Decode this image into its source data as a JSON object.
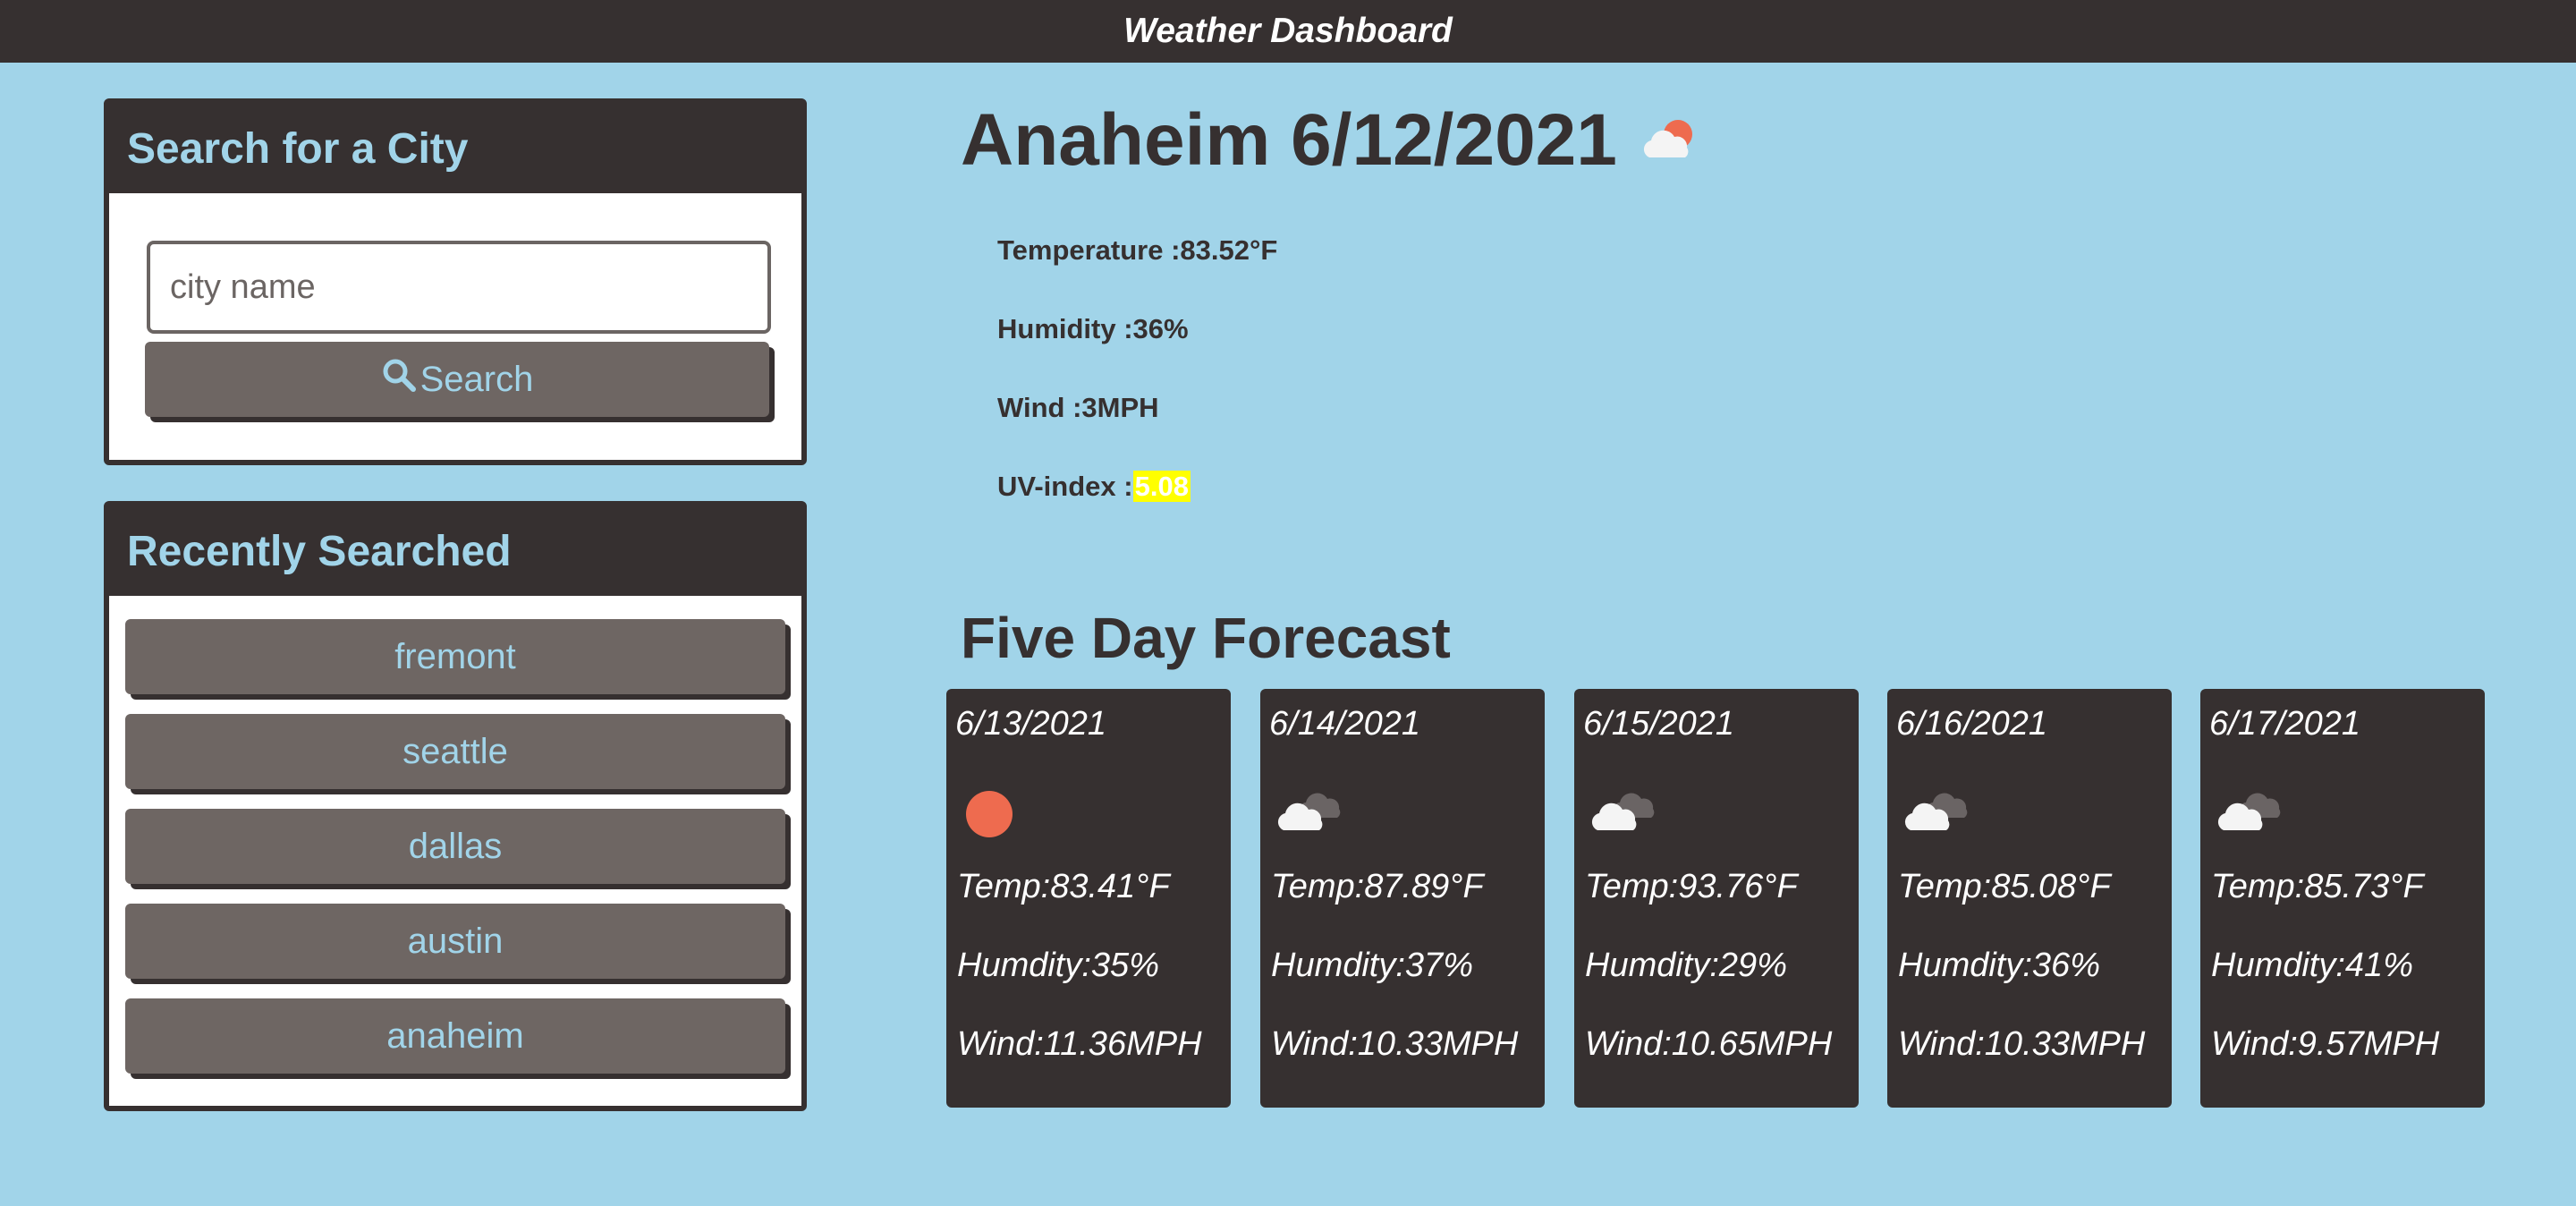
{
  "header": {
    "title": "Weather Dashboard"
  },
  "search": {
    "heading": "Search for a City",
    "placeholder": "city name",
    "value": "",
    "button_label": "Search",
    "button_icon": "search-icon"
  },
  "recent": {
    "heading": "Recently Searched",
    "items": [
      "fremont",
      "seattle",
      "dallas",
      "austin",
      "anaheim"
    ]
  },
  "current": {
    "title": "Anaheim 6/12/2021",
    "icon": "partly-cloudy-icon",
    "temperature": "Temperature :83.52°F",
    "humidity": "Humidity :36%",
    "wind": "Wind :3MPH",
    "uv_label": "UV-index :",
    "uv_value": "5.08",
    "uv_color": "#ffff00"
  },
  "forecast": {
    "heading": "Five Day Forecast",
    "days": [
      {
        "date": "6/13/2021",
        "icon": "sun-icon",
        "temp": "Temp:83.41°F",
        "humidity": "Humdity:35%",
        "wind": "Wind:11.36MPH"
      },
      {
        "date": "6/14/2021",
        "icon": "clouds-icon",
        "temp": "Temp:87.89°F",
        "humidity": "Humdity:37%",
        "wind": "Wind:10.33MPH"
      },
      {
        "date": "6/15/2021",
        "icon": "clouds-icon",
        "temp": "Temp:93.76°F",
        "humidity": "Humdity:29%",
        "wind": "Wind:10.65MPH"
      },
      {
        "date": "6/16/2021",
        "icon": "clouds-icon",
        "temp": "Temp:85.08°F",
        "humidity": "Humdity:36%",
        "wind": "Wind:10.33MPH"
      },
      {
        "date": "6/17/2021",
        "icon": "clouds-icon",
        "temp": "Temp:85.73°F",
        "humidity": "Humdity:41%",
        "wind": "Wind:9.57MPH"
      }
    ]
  },
  "colors": {
    "background": "#a1d4e9",
    "dark": "#363030",
    "button": "#6e6663",
    "accent_text": "#a1d4e9",
    "sun": "#ee6b4f"
  }
}
